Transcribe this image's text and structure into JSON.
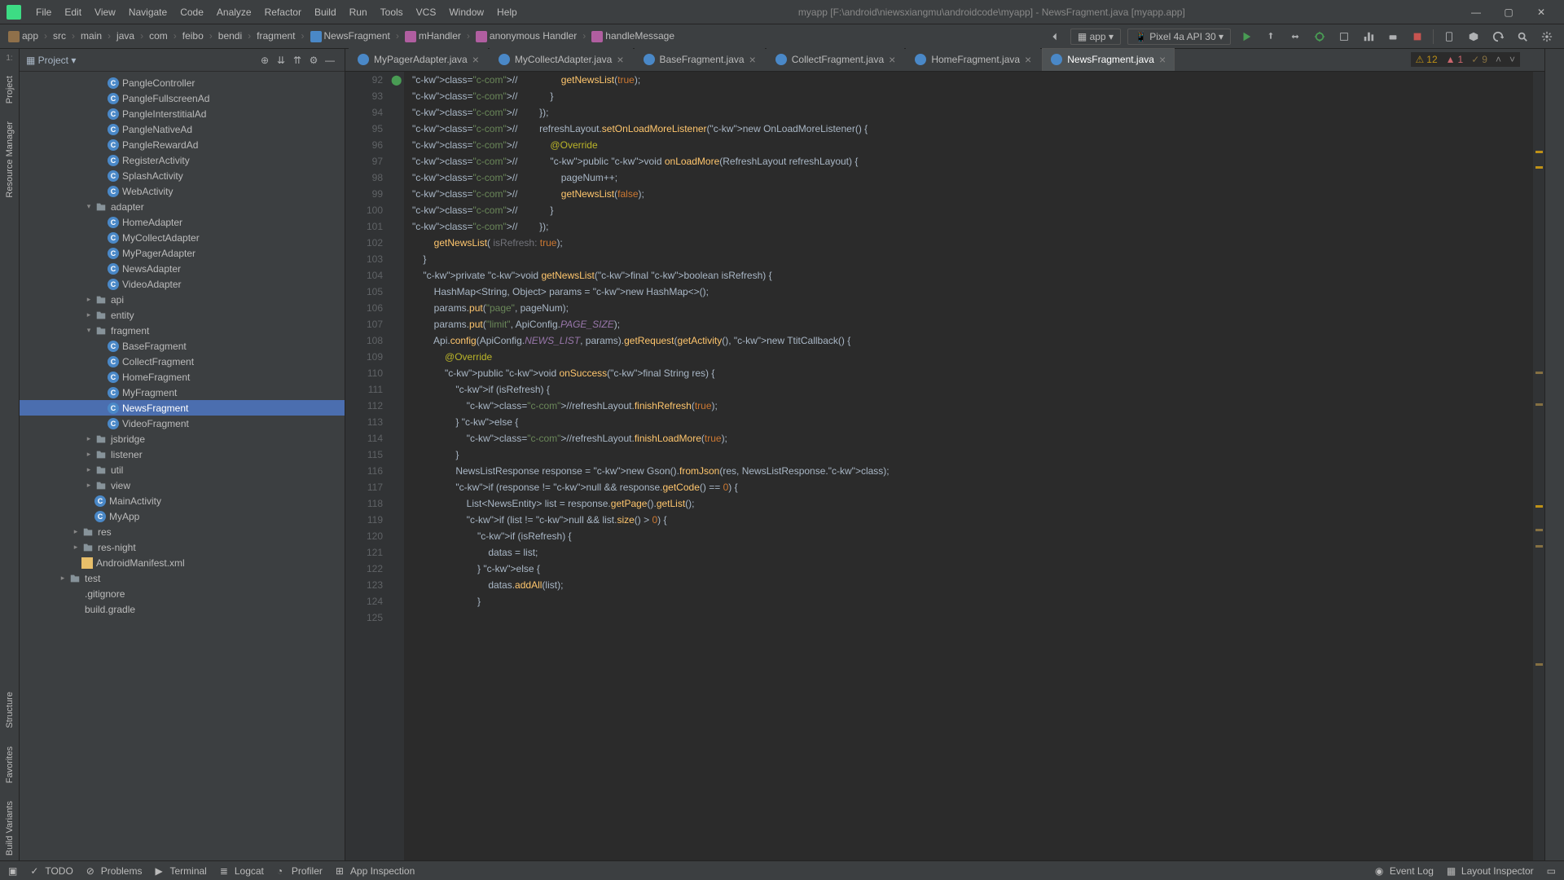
{
  "window": {
    "title": "myapp [F:\\android\\niewsxiangmu\\androidcode\\myapp] - NewsFragment.java [myapp.app]"
  },
  "menu": [
    "File",
    "Edit",
    "View",
    "Navigate",
    "Code",
    "Analyze",
    "Refactor",
    "Build",
    "Run",
    "Tools",
    "VCS",
    "Window",
    "Help"
  ],
  "breadcrumbs": [
    "app",
    "src",
    "main",
    "java",
    "com",
    "feibo",
    "bendi",
    "fragment",
    "NewsFragment",
    "mHandler",
    "anonymous Handler",
    "handleMessage"
  ],
  "run_config": {
    "target": "app",
    "device": "Pixel 4a API 30"
  },
  "project_panel": {
    "title": "Project"
  },
  "tree": [
    {
      "depth": 4,
      "kind": "class",
      "label": "PangleController"
    },
    {
      "depth": 4,
      "kind": "class",
      "label": "PangleFullscreenAd"
    },
    {
      "depth": 4,
      "kind": "class",
      "label": "PangleInterstitialAd"
    },
    {
      "depth": 4,
      "kind": "class",
      "label": "PangleNativeAd"
    },
    {
      "depth": 4,
      "kind": "class",
      "label": "PangleRewardAd"
    },
    {
      "depth": 4,
      "kind": "class",
      "label": "RegisterActivity"
    },
    {
      "depth": 4,
      "kind": "class",
      "label": "SplashActivity"
    },
    {
      "depth": 4,
      "kind": "class",
      "label": "WebActivity"
    },
    {
      "depth": 3,
      "kind": "folder",
      "label": "adapter",
      "arrow": "▾"
    },
    {
      "depth": 4,
      "kind": "class",
      "label": "HomeAdapter"
    },
    {
      "depth": 4,
      "kind": "class",
      "label": "MyCollectAdapter"
    },
    {
      "depth": 4,
      "kind": "class",
      "label": "MyPagerAdapter"
    },
    {
      "depth": 4,
      "kind": "class",
      "label": "NewsAdapter"
    },
    {
      "depth": 4,
      "kind": "class",
      "label": "VideoAdapter"
    },
    {
      "depth": 3,
      "kind": "folder",
      "label": "api",
      "arrow": "▸"
    },
    {
      "depth": 3,
      "kind": "folder",
      "label": "entity",
      "arrow": "▸"
    },
    {
      "depth": 3,
      "kind": "folder",
      "label": "fragment",
      "arrow": "▾"
    },
    {
      "depth": 4,
      "kind": "class",
      "label": "BaseFragment"
    },
    {
      "depth": 4,
      "kind": "class",
      "label": "CollectFragment"
    },
    {
      "depth": 4,
      "kind": "class",
      "label": "HomeFragment"
    },
    {
      "depth": 4,
      "kind": "class",
      "label": "MyFragment"
    },
    {
      "depth": 4,
      "kind": "class",
      "label": "NewsFragment",
      "selected": true
    },
    {
      "depth": 4,
      "kind": "class",
      "label": "VideoFragment"
    },
    {
      "depth": 3,
      "kind": "folder",
      "label": "jsbridge",
      "arrow": "▸"
    },
    {
      "depth": 3,
      "kind": "folder",
      "label": "listener",
      "arrow": "▸"
    },
    {
      "depth": 3,
      "kind": "folder",
      "label": "util",
      "arrow": "▸"
    },
    {
      "depth": 3,
      "kind": "folder",
      "label": "view",
      "arrow": "▸"
    },
    {
      "depth": 3,
      "kind": "class",
      "label": "MainActivity"
    },
    {
      "depth": 3,
      "kind": "class",
      "label": "MyApp"
    },
    {
      "depth": 2,
      "kind": "folder",
      "label": "res",
      "arrow": "▸"
    },
    {
      "depth": 2,
      "kind": "folder",
      "label": "res-night",
      "arrow": "▸"
    },
    {
      "depth": 2,
      "kind": "xml",
      "label": "AndroidManifest.xml"
    },
    {
      "depth": 1,
      "kind": "folder",
      "label": "test",
      "arrow": "▸"
    },
    {
      "depth": 1,
      "kind": "file",
      "label": ".gitignore"
    },
    {
      "depth": 1,
      "kind": "file",
      "label": "build.gradle"
    }
  ],
  "tabs": [
    {
      "label": "MyPagerAdapter.java"
    },
    {
      "label": "MyCollectAdapter.java"
    },
    {
      "label": "BaseFragment.java"
    },
    {
      "label": "CollectFragment.java"
    },
    {
      "label": "HomeFragment.java"
    },
    {
      "label": "NewsFragment.java",
      "active": true
    }
  ],
  "inspections": {
    "warnings": "12",
    "errors": "1",
    "weak": "9"
  },
  "code": {
    "first_line": 92,
    "lines": [
      "//                getNewsList(true);",
      "//            }",
      "//        });",
      "//        refreshLayout.setOnLoadMoreListener(new OnLoadMoreListener() {",
      "//            @Override",
      "//            public void onLoadMore(RefreshLayout refreshLayout) {",
      "//                pageNum++;",
      "//                getNewsList(false);",
      "//            }",
      "//        });",
      "        getNewsList( isRefresh: true);",
      "    }",
      "",
      "    private void getNewsList(final boolean isRefresh) {",
      "        HashMap<String, Object> params = new HashMap<>();",
      "        params.put(\"page\", pageNum);",
      "        params.put(\"limit\", ApiConfig.PAGE_SIZE);",
      "        Api.config(ApiConfig.NEWS_LIST, params).getRequest(getActivity(), new TtitCallback() {",
      "            @Override",
      "            public void onSuccess(final String res) {",
      "                if (isRefresh) {",
      "                    //refreshLayout.finishRefresh(true);",
      "                } else {",
      "                    //refreshLayout.finishLoadMore(true);",
      "                }",
      "                NewsListResponse response = new Gson().fromJson(res, NewsListResponse.class);",
      "                if (response != null && response.getCode() == 0) {",
      "                    List<NewsEntity> list = response.getPage().getList();",
      "                    if (list != null && list.size() > 0) {",
      "                        if (isRefresh) {",
      "                            datas = list;",
      "                        } else {",
      "                            datas.addAll(list);",
      "                        }"
    ]
  },
  "sidetabs_left": [
    "Project",
    "Resource Manager",
    "Structure",
    "Favorites",
    "Build Variants"
  ],
  "statusbar": {
    "items_left": [
      "TODO",
      "Problems",
      "Terminal",
      "Logcat",
      "Profiler",
      "App Inspection"
    ],
    "items_right": [
      "Event Log",
      "Layout Inspector"
    ]
  }
}
